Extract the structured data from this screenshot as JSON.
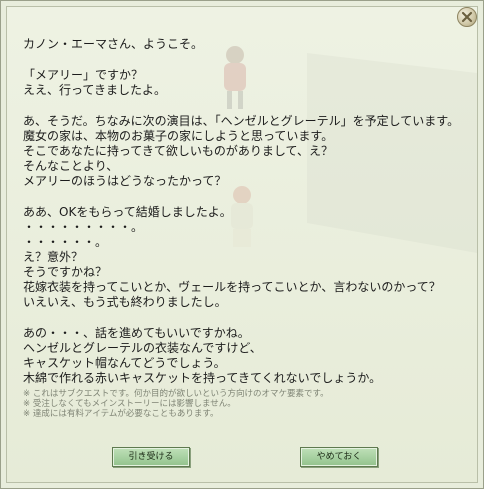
{
  "dialog": {
    "close_icon": "close-x-icon",
    "lines": [
      "カノン・エーマさん、ようこそ。",
      "",
      "「メアリー」ですか？",
      "ええ、行ってきましたよ。",
      "",
      "あ、そうだ。ちなみに次の演目は、「ヘンゼルとグレーテル」を予定しています。",
      "魔女の家は、本物のお菓子の家にしようと思っています。",
      "そこであなたに持ってきて欲しいものがありまして、え？",
      "そんなことより、",
      "メアリーのほうはどうなったかって？",
      "",
      "ああ、OKをもらって結婚しましたよ。",
      "・・・・・・・・・。",
      "・・・・・・。",
      "え？意外？",
      "そうですかね？",
      "花嫁衣装を持ってこいとか、ヴェールを持ってこいとか、言わないのかって？",
      "いえいえ、もう式も終わりましたし。",
      "",
      "あの・・・、話を進めてもいいですかね。",
      "ヘンゼルとグレーテルの衣装なんですけど、",
      "キャスケット帽なんてどうでしょう。",
      "木綿で作れる赤いキャスケットを持ってきてくれないでしょうか。"
    ],
    "notes": [
      "※ これはサブクエストです。何か目的が欲しいという方向けのオマケ要素です。",
      "※ 受注しなくてもメインストーリーには影響しません。",
      "※ 達成には有料アイテムが必要なこともあります。"
    ],
    "accept_label": "引き受ける",
    "decline_label": "やめておく"
  }
}
